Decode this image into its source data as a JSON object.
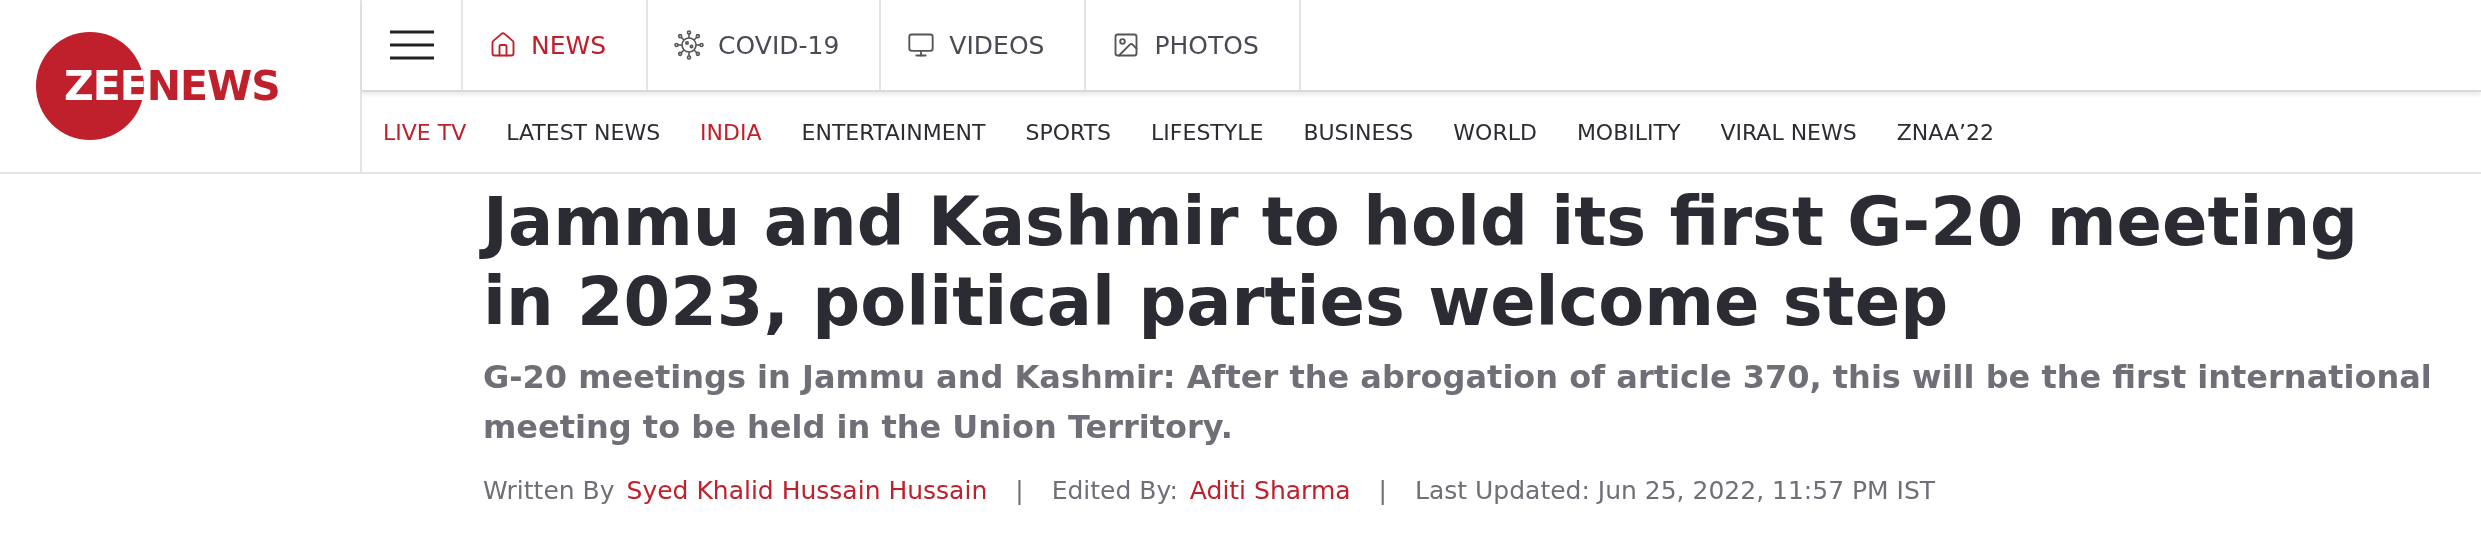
{
  "logo": {
    "part_1": "ZEE",
    "part_2": "NEWS"
  },
  "top_nav": [
    {
      "label": "NEWS",
      "selected": true
    },
    {
      "label": "COVID-19",
      "selected": false
    },
    {
      "label": "VIDEOS",
      "selected": false
    },
    {
      "label": "PHOTOS",
      "selected": false
    }
  ],
  "section_nav": [
    {
      "label": "LIVE TV",
      "selected": true
    },
    {
      "label": "LATEST NEWS",
      "selected": false
    },
    {
      "label": "INDIA",
      "selected": true
    },
    {
      "label": "ENTERTAINMENT",
      "selected": false
    },
    {
      "label": "SPORTS",
      "selected": false
    },
    {
      "label": "LIFESTYLE",
      "selected": false
    },
    {
      "label": "BUSINESS",
      "selected": false
    },
    {
      "label": "WORLD",
      "selected": false
    },
    {
      "label": "MOBILITY",
      "selected": false
    },
    {
      "label": "VIRAL NEWS",
      "selected": false
    },
    {
      "label": "ZNAA’22",
      "selected": false
    }
  ],
  "article": {
    "headline": "Jammu and Kashmir to hold its first G-20 meeting in 2023, political parties welcome step",
    "summary": "G-20 meetings in Jammu and Kashmir: After the abrogation of article 370, this will be the first international meeting to be held in the Union Territory.",
    "byline": [
      {
        "label": "Written By",
        "name": "Syed Khalid Hussain Hussain"
      },
      {
        "label": "Edited By:",
        "name": "Aditi Sharma"
      },
      {
        "label": "Last Updated: Jun 25, 2022, 11:57 PM IST"
      }
    ],
    "separator": "|"
  }
}
